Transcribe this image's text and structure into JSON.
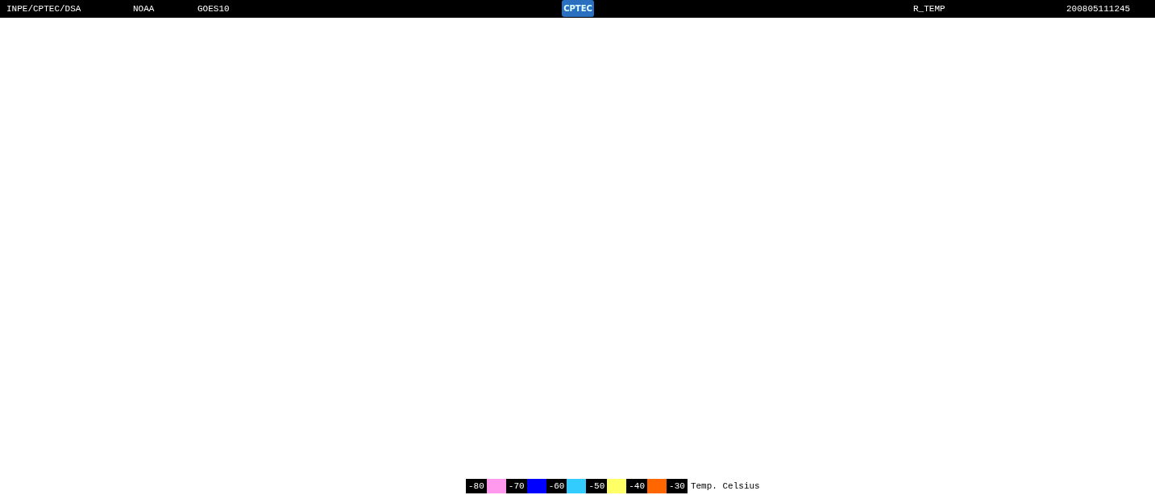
{
  "header": {
    "institution": "INPE/CPTEC/DSA",
    "agency": "NOAA",
    "satellite": "GOES10",
    "logo": "CPTEC",
    "product": "R_TEMP",
    "timestamp": "200805111245"
  },
  "legend": {
    "items": [
      {
        "label": "-80",
        "color": "#ff99ee"
      },
      {
        "label": "-70",
        "color": "#0000ff"
      },
      {
        "label": "-60",
        "color": "#33ccff"
      },
      {
        "label": "-50",
        "color": "#ffff66"
      },
      {
        "label": "-40",
        "color": "#ff6600"
      },
      {
        "label": "-30"
      }
    ],
    "unit": "Temp. Celsius"
  }
}
